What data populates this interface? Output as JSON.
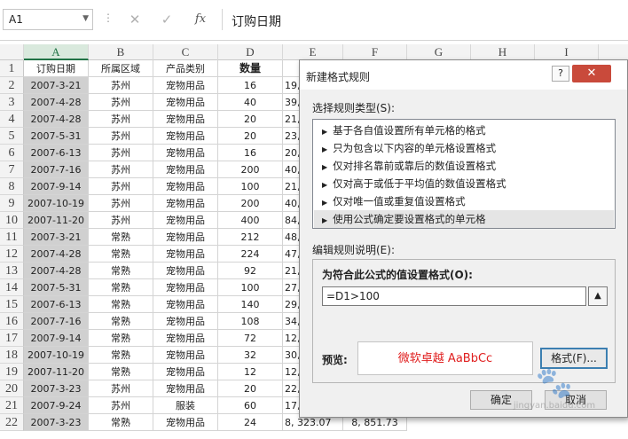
{
  "formula_bar": {
    "name_box": "A1",
    "fx_symbol": "fx",
    "formula": "订购日期"
  },
  "columns": [
    "A",
    "B",
    "C",
    "D",
    "E",
    "F",
    "G",
    "H",
    "I"
  ],
  "rows": [
    {
      "num": "1",
      "a": "订购日期",
      "b": "所属区域",
      "c": "产品类别",
      "d": "数量",
      "e": "",
      "f": ""
    },
    {
      "num": "2",
      "a": "2007-3-21",
      "b": "苏州",
      "c": "宠物用品",
      "d": "16",
      "e": "19,",
      "f": ""
    },
    {
      "num": "3",
      "a": "2007-4-28",
      "b": "苏州",
      "c": "宠物用品",
      "d": "40",
      "e": "39,",
      "f": ""
    },
    {
      "num": "4",
      "a": "2007-4-28",
      "b": "苏州",
      "c": "宠物用品",
      "d": "20",
      "e": "21,",
      "f": ""
    },
    {
      "num": "5",
      "a": "2007-5-31",
      "b": "苏州",
      "c": "宠物用品",
      "d": "20",
      "e": "23,",
      "f": ""
    },
    {
      "num": "6",
      "a": "2007-6-13",
      "b": "苏州",
      "c": "宠物用品",
      "d": "16",
      "e": "20,",
      "f": ""
    },
    {
      "num": "7",
      "a": "2007-7-16",
      "b": "苏州",
      "c": "宠物用品",
      "d": "200",
      "e": "40,",
      "f": ""
    },
    {
      "num": "8",
      "a": "2007-9-14",
      "b": "苏州",
      "c": "宠物用品",
      "d": "100",
      "e": "21,",
      "f": ""
    },
    {
      "num": "9",
      "a": "2007-10-19",
      "b": "苏州",
      "c": "宠物用品",
      "d": "200",
      "e": "40,",
      "f": ""
    },
    {
      "num": "10",
      "a": "2007-11-20",
      "b": "苏州",
      "c": "宠物用品",
      "d": "400",
      "e": "84,",
      "f": ""
    },
    {
      "num": "11",
      "a": "2007-3-21",
      "b": "常熟",
      "c": "宠物用品",
      "d": "212",
      "e": "48,",
      "f": ""
    },
    {
      "num": "12",
      "a": "2007-4-28",
      "b": "常熟",
      "c": "宠物用品",
      "d": "224",
      "e": "47,",
      "f": ""
    },
    {
      "num": "13",
      "a": "2007-4-28",
      "b": "常熟",
      "c": "宠物用品",
      "d": "92",
      "e": "21,",
      "f": ""
    },
    {
      "num": "14",
      "a": "2007-5-31",
      "b": "常熟",
      "c": "宠物用品",
      "d": "100",
      "e": "27,",
      "f": ""
    },
    {
      "num": "15",
      "a": "2007-6-13",
      "b": "常熟",
      "c": "宠物用品",
      "d": "140",
      "e": "29,",
      "f": ""
    },
    {
      "num": "16",
      "a": "2007-7-16",
      "b": "常熟",
      "c": "宠物用品",
      "d": "108",
      "e": "34,",
      "f": ""
    },
    {
      "num": "17",
      "a": "2007-9-14",
      "b": "常熟",
      "c": "宠物用品",
      "d": "72",
      "e": "12,",
      "f": ""
    },
    {
      "num": "18",
      "a": "2007-10-19",
      "b": "常熟",
      "c": "宠物用品",
      "d": "32",
      "e": "30,",
      "f": ""
    },
    {
      "num": "19",
      "a": "2007-11-20",
      "b": "常熟",
      "c": "宠物用品",
      "d": "12",
      "e": "12,",
      "f": ""
    },
    {
      "num": "20",
      "a": "2007-3-23",
      "b": "苏州",
      "c": "宠物用品",
      "d": "20",
      "e": "22,",
      "f": ""
    },
    {
      "num": "21",
      "a": "2007-9-24",
      "b": "苏州",
      "c": "服装",
      "d": "60",
      "e": "17,",
      "f": ""
    },
    {
      "num": "22",
      "a": "2007-3-23",
      "b": "常熟",
      "c": "宠物用品",
      "d": "24",
      "e": "8, 323.07",
      "f": "8, 851.73"
    }
  ],
  "dialog": {
    "title": "新建格式规则",
    "help": "?",
    "close": "✕",
    "rule_type_label": "选择规则类型(S):",
    "rule_types": [
      "基于各自值设置所有单元格的格式",
      "只为包含以下内容的单元格设置格式",
      "仅对排名靠前或靠后的数值设置格式",
      "仅对高于或低于平均值的数值设置格式",
      "仅对唯一值或重复值设置格式",
      "使用公式确定要设置格式的单元格"
    ],
    "edit_label": "编辑规则说明(E):",
    "formula_label": "为符合此公式的值设置格式(O):",
    "formula_value": "=D1>100",
    "preview_label": "预览:",
    "preview_text": "微软卓越  AaBbCc",
    "format_button": "格式(F)...",
    "ok_button": "确定",
    "cancel_button": "取消"
  },
  "watermark": {
    "text": "jingyan.baidu.com",
    "logo": "Bai"
  }
}
